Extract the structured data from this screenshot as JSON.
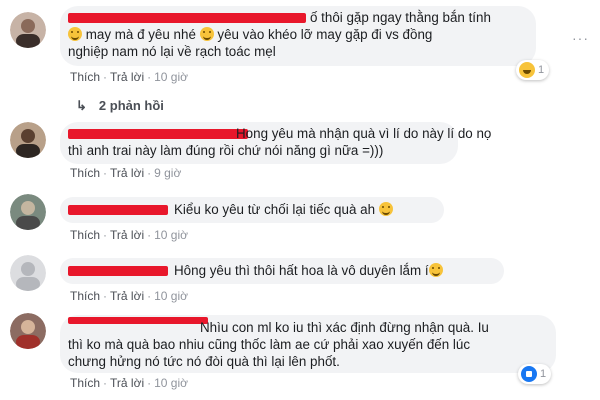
{
  "comments": [
    {
      "lines": [
        "ố thôi gặp ngay thằng bắn tính",
        "may mà đ yêu nhé",
        "yêu vào khéo lỡ may gặp đi vs đồng",
        "nghiệp nam nó lại về rạch toác mẹl"
      ],
      "like": "Thích",
      "reply": "Trả lời",
      "time": "10 giờ",
      "reaction": {
        "icon": "haha-reaction-icon",
        "count": "1"
      },
      "replies": "2 phản hồi"
    },
    {
      "lines": [
        "Hong yêu mà nhận quà vì lí do này lí do nọ",
        "thì anh trai này làm đúng rồi chứ nói năng gì nữa =)))"
      ],
      "like": "Thích",
      "reply": "Trả lời",
      "time": "9 giờ"
    },
    {
      "lines": [
        "Kiểu ko yêu từ chối lại tiếc quà ah"
      ],
      "like": "Thích",
      "reply": "Trả lời",
      "time": "10 giờ"
    },
    {
      "lines": [
        "Hông yêu thì thôi hất hoa là vô duyên lắm í"
      ],
      "like": "Thích",
      "reply": "Trả lời",
      "time": "10 giờ"
    },
    {
      "lines": [
        "Nhìu con ml ko iu thì xác định đừng nhận quà. Iu",
        "thì ko mà quà bao nhiu cũng thốc làm ae cứ phải xao xuyến đến lúc",
        "chưng hửng nó tức nó đòi quà thì lại lên phốt."
      ],
      "like": "Thích",
      "reply": "Trả lời",
      "time": "10 giờ",
      "reaction": {
        "icon": "like-reaction-icon",
        "count": "1"
      }
    }
  ],
  "more_label": "···",
  "colors": {
    "bubble": "#f2f3f5",
    "redaction": "#e8172b",
    "link": "#4b4f56",
    "muted": "#90949c"
  }
}
